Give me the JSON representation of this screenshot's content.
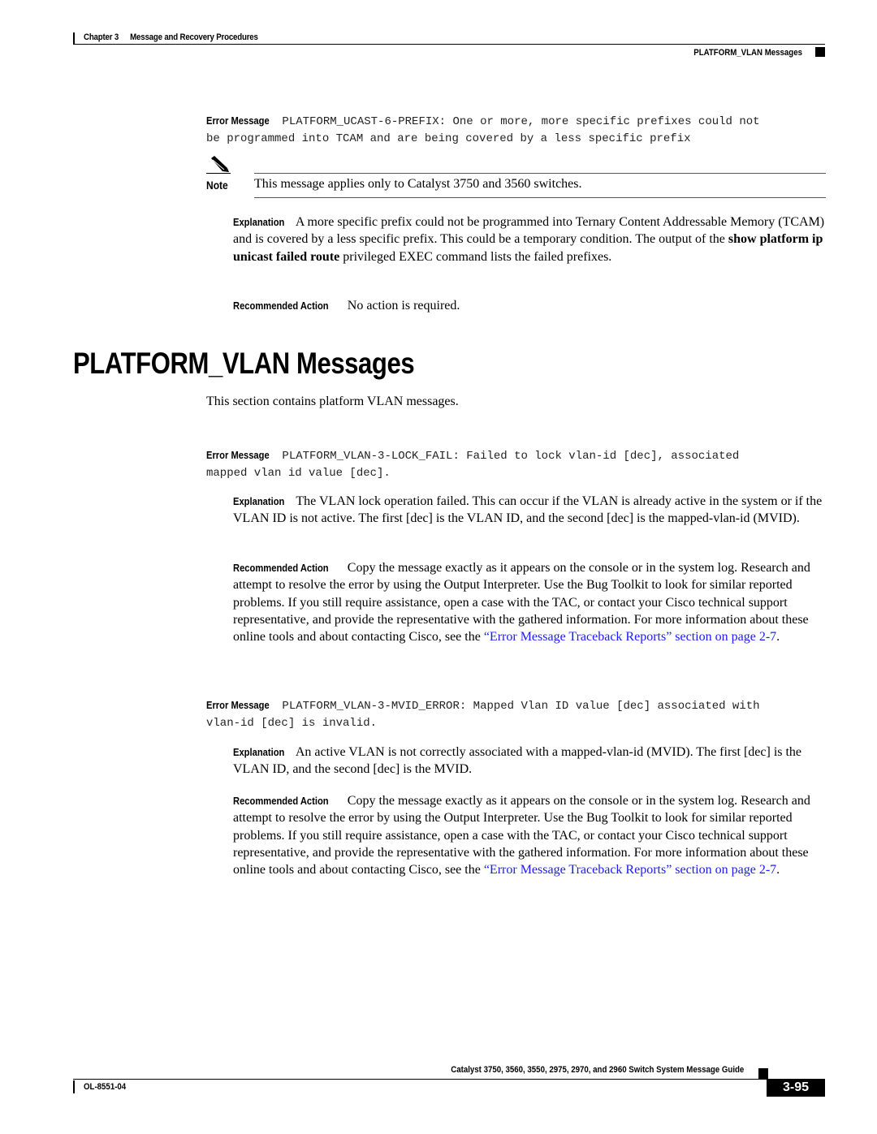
{
  "header": {
    "chapter": "Chapter 3",
    "chapter_title": "Message and Recovery Procedures",
    "section": "PLATFORM_VLAN Messages"
  },
  "labels": {
    "error_message": "Error Message",
    "explanation": "Explanation",
    "recommended_action": "Recommended Action",
    "note": "Note"
  },
  "prefix_entry": {
    "code": "PLATFORM_UCAST-6-PREFIX:",
    "message_line1": " One or more, more specific prefixes could not",
    "message_line2": "be programmed into TCAM and are being covered by a less specific prefix",
    "note_text": "This message applies only to Catalyst 3750 and 3560 switches.",
    "explanation_pre": "A more specific prefix could not be programmed into Ternary Content Addressable Memory (TCAM) and is covered by a less specific prefix. This could be a temporary condition. The output of the ",
    "explanation_cmd": "show platform ip unicast failed route",
    "explanation_post": " privileged EXEC command lists the failed prefixes.",
    "action": "No action is required."
  },
  "section": {
    "title": "PLATFORM_VLAN Messages",
    "intro": "This section contains platform VLAN messages."
  },
  "entries": [
    {
      "code": "PLATFORM_VLAN-3-LOCK_FAIL:",
      "message_line1": " Failed to lock vlan-id [dec], associated",
      "message_line2": "mapped vlan id value [dec].",
      "explanation": "The VLAN lock operation failed. This can occur if the VLAN is already active in the system or if the VLAN ID is not active. The first [dec] is the VLAN ID, and the second [dec] is the mapped-vlan-id (MVID).",
      "action": "Copy the message exactly as it appears on the console or in the system log. Research and attempt to resolve the error by using the Output Interpreter. Use the Bug Toolkit to look for similar reported problems. If you still require assistance, open a case with the TAC, or contact your Cisco technical support representative, and provide the representative with the gathered information. For more information about these online tools and about contacting Cisco, see the ",
      "action_link": "“Error Message Traceback Reports” section on page 2-7",
      "action_end": "."
    },
    {
      "code": "PLATFORM_VLAN-3-MVID_ERROR:",
      "message_line1": " Mapped Vlan ID value [dec] associated with",
      "message_line2": "vlan-id [dec] is invalid.",
      "explanation": "An active VLAN is not correctly associated with a mapped-vlan-id (MVID). The first [dec] is the VLAN ID, and the second [dec] is the MVID.",
      "action": "Copy the message exactly as it appears on the console or in the system log. Research and attempt to resolve the error by using the Output Interpreter. Use the Bug Toolkit to look for similar reported problems. If you still require assistance, open a case with the TAC, or contact your Cisco technical support representative, and provide the representative with the gathered information. For more information about these online tools and about contacting Cisco, see the ",
      "action_link": "“Error Message Traceback Reports” section on page 2-7",
      "action_end": "."
    }
  ],
  "footer": {
    "guide_title": "Catalyst 3750, 3560, 3550, 2975, 2970, and 2960 Switch System Message Guide",
    "doc_number": "OL-8551-04",
    "page_number": "3-95"
  },
  "colors": {
    "link": "#1a1aff"
  }
}
